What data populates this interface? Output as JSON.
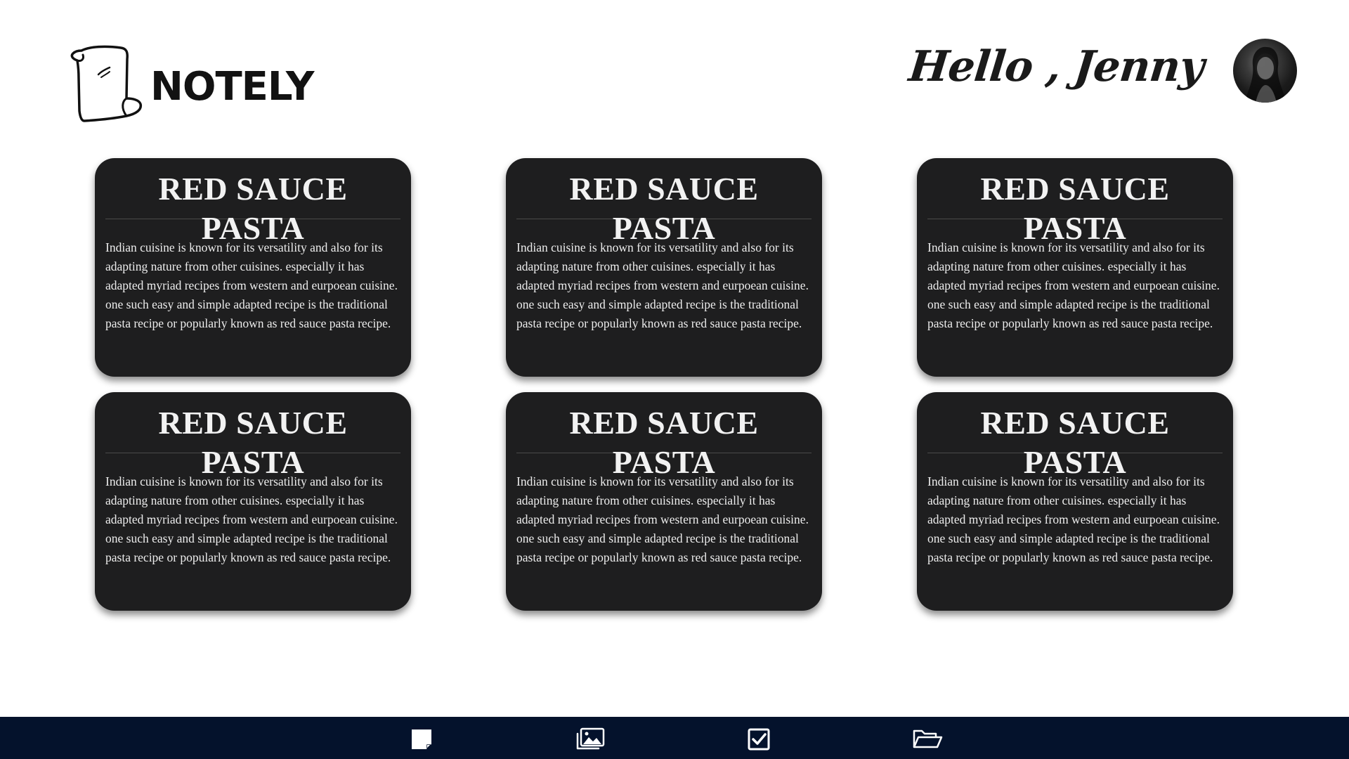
{
  "brand": {
    "name": "NOTELY"
  },
  "header": {
    "greeting": "Hello , Jenny"
  },
  "notes": [
    {
      "title": "RED SAUCE PASTA",
      "body": "Indian cuisine is known for its versatility and also for its adapting nature from other cuisines. especially it has adapted myriad recipes from western and eurpoean cuisine. one such easy and simple adapted recipe is the traditional pasta recipe or popularly known as red sauce pasta recipe."
    },
    {
      "title": "RED SAUCE PASTA",
      "body": "Indian cuisine is known for its versatility and also for its adapting nature from other cuisines. especially it has adapted myriad recipes from western and eurpoean cuisine. one such easy and simple adapted recipe is the traditional pasta recipe or popularly known as red sauce pasta recipe."
    },
    {
      "title": "RED SAUCE PASTA",
      "body": "Indian cuisine is known for its versatility and also for its adapting nature from other cuisines. especially it has adapted myriad recipes from western and eurpoean cuisine. one such easy and simple adapted recipe is the traditional pasta recipe or popularly known as red sauce pasta recipe."
    },
    {
      "title": "RED SAUCE PASTA",
      "body": "Indian cuisine is known for its versatility and also for its adapting nature from other cuisines. especially it has adapted myriad recipes from western and eurpoean cuisine. one such easy and simple adapted recipe is the traditional pasta recipe or popularly known as red sauce pasta recipe."
    },
    {
      "title": "RED SAUCE PASTA",
      "body": "Indian cuisine is known for its versatility and also for its adapting nature from other cuisines. especially it has adapted myriad recipes from western and eurpoean cuisine. one such easy and simple adapted recipe is the traditional pasta recipe or popularly known as red sauce pasta recipe."
    },
    {
      "title": "RED SAUCE PASTA",
      "body": "Indian cuisine is known for its versatility and also for its adapting nature from other cuisines. especially it has adapted myriad recipes from western and eurpoean cuisine. one such easy and simple adapted recipe is the traditional pasta recipe or popularly known as red sauce pasta recipe."
    }
  ],
  "bottom_nav": {
    "items": [
      {
        "icon": "note-icon"
      },
      {
        "icon": "images-icon"
      },
      {
        "icon": "checkbox-icon"
      },
      {
        "icon": "folder-open-icon"
      }
    ]
  },
  "colors": {
    "card_background": "#1e1e1f",
    "nav_background": "#04122c",
    "page_background": "#ffffff"
  }
}
